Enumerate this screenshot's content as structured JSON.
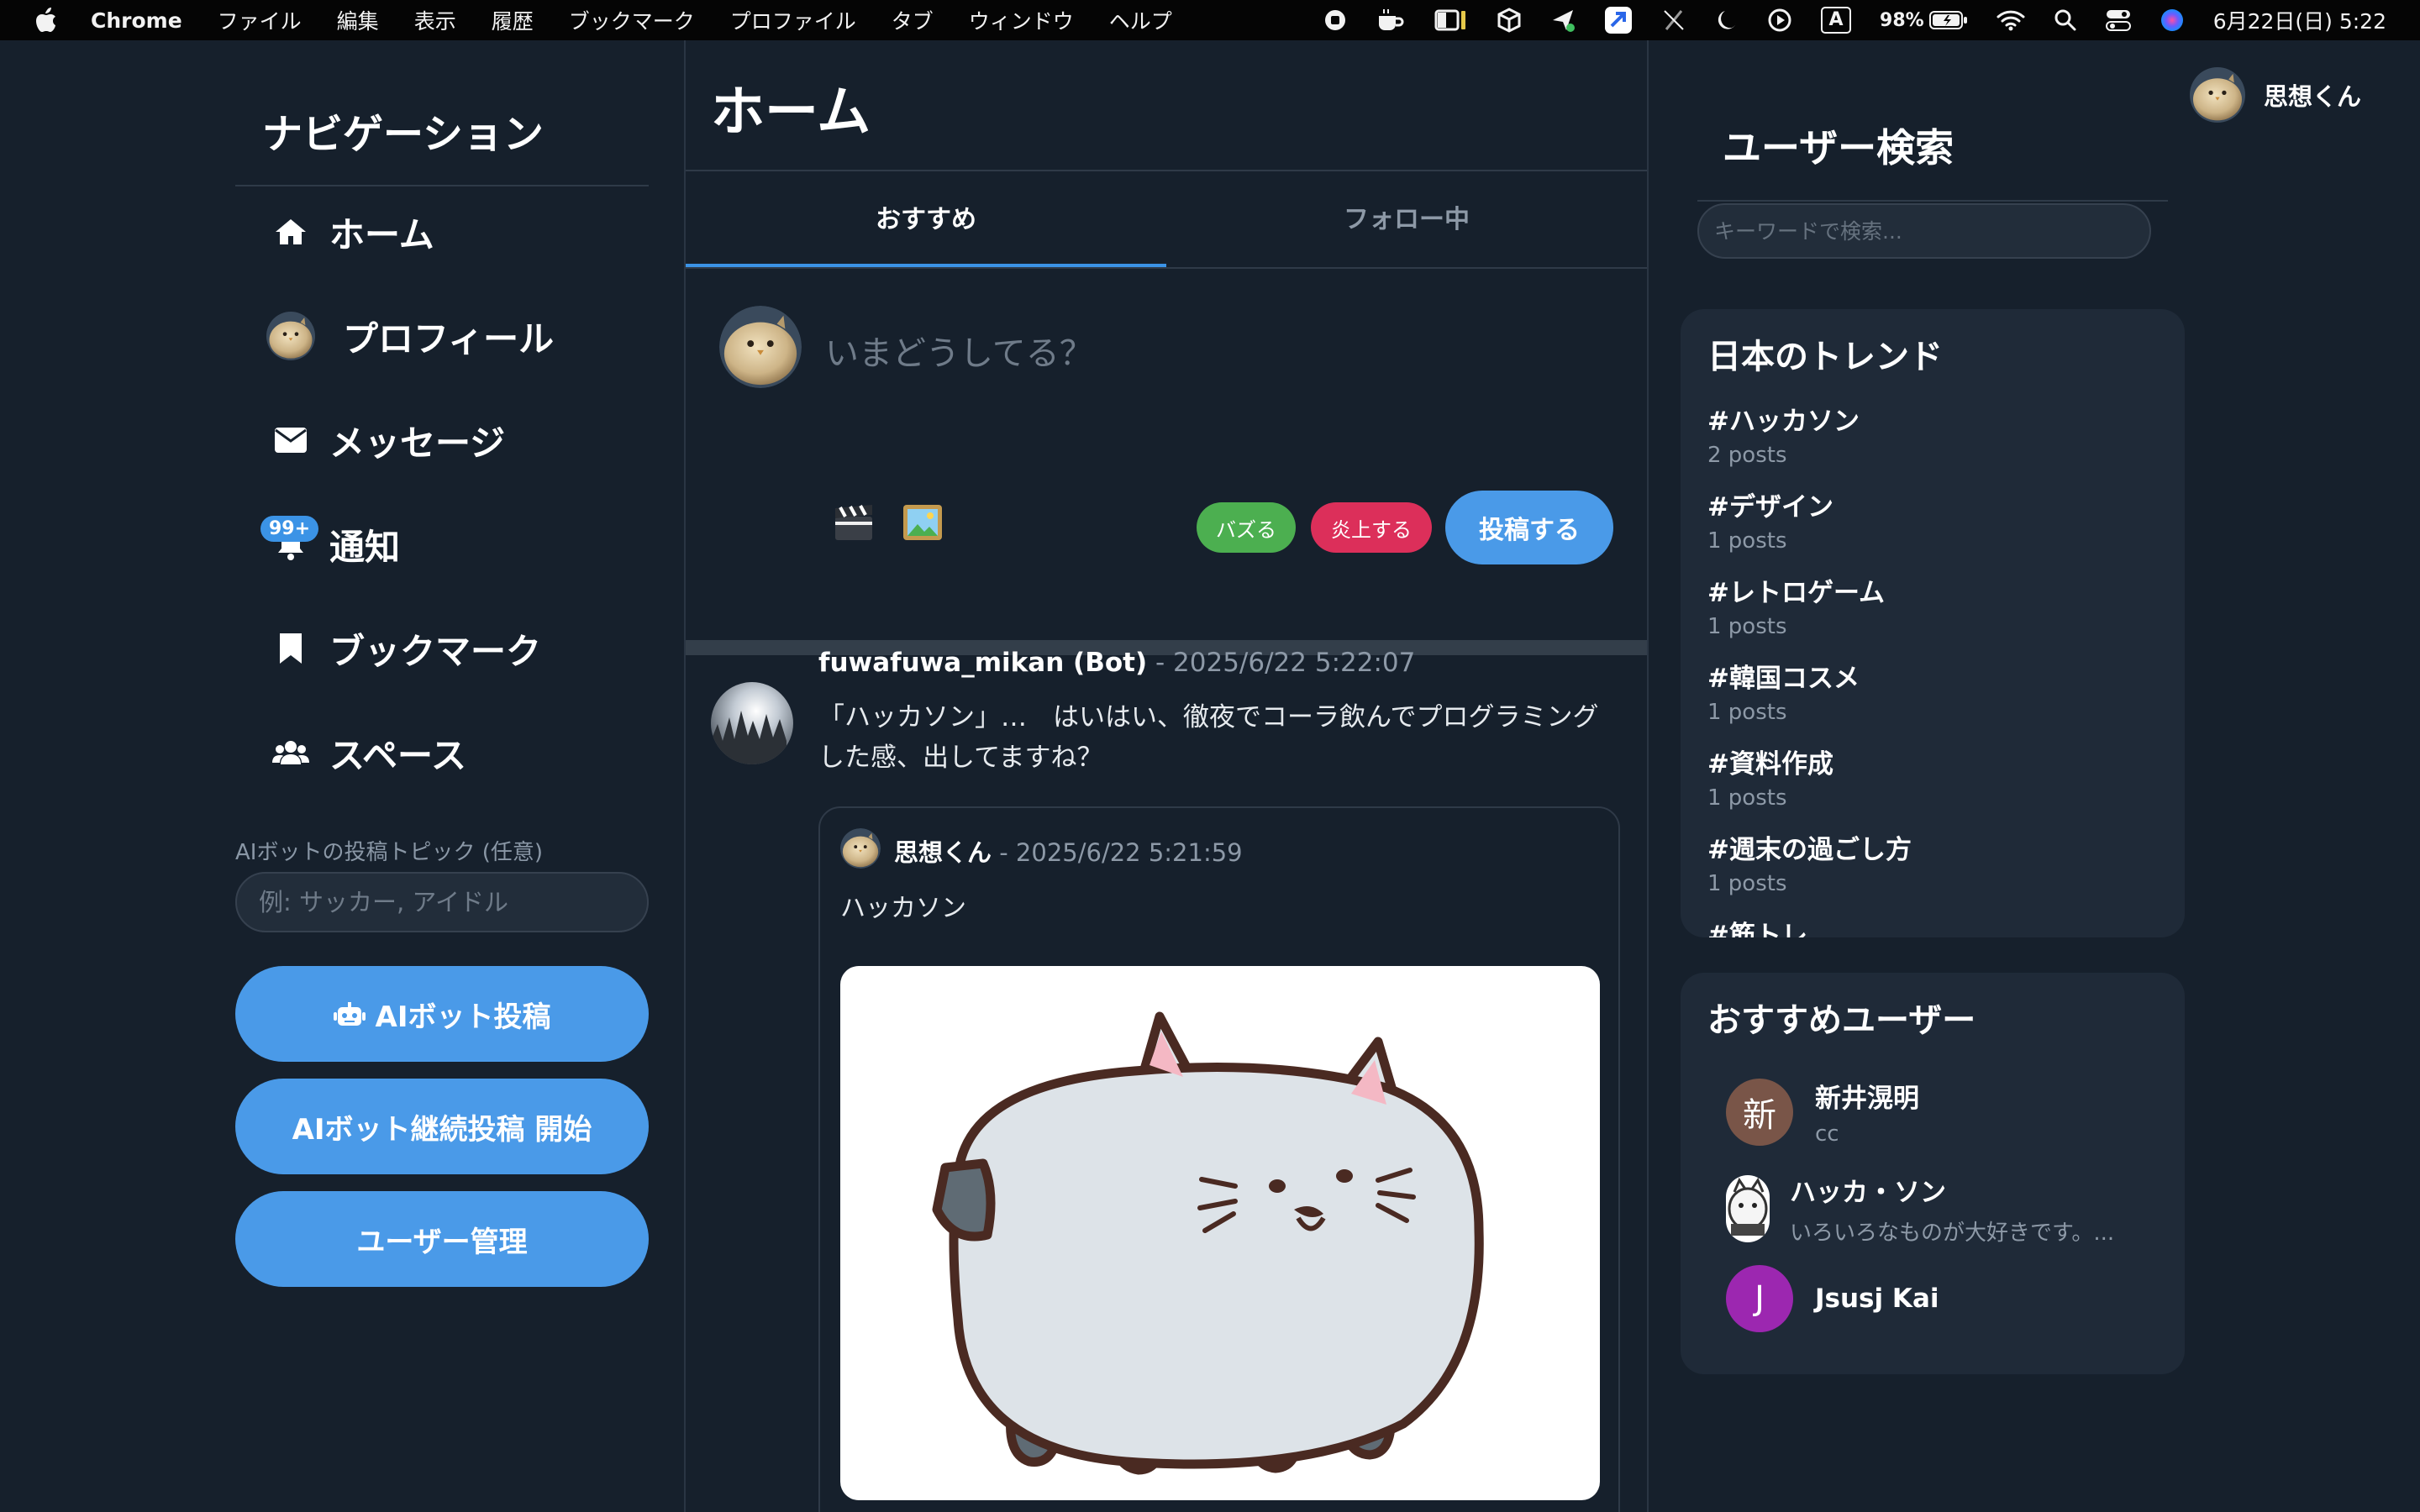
{
  "menubar": {
    "app": "Chrome",
    "items": [
      "ファイル",
      "編集",
      "表示",
      "履歴",
      "ブックマーク",
      "プロファイル",
      "タブ",
      "ウィンドウ",
      "ヘルプ"
    ],
    "battery": "98%",
    "input_mode": "A",
    "clock": "6月22日(日) 5:22"
  },
  "nav": {
    "title": "ナビゲーション",
    "items": [
      {
        "label": "ホーム",
        "icon": "home-icon"
      },
      {
        "label": "プロフィール",
        "icon": "avatar"
      },
      {
        "label": "メッセージ",
        "icon": "envelope-icon"
      },
      {
        "label": "通知",
        "icon": "bell-icon",
        "badge": "99+"
      },
      {
        "label": "ブックマーク",
        "icon": "bookmark-icon"
      },
      {
        "label": "スペース",
        "icon": "users-icon"
      }
    ],
    "topic_label": "AIボットの投稿トピック (任意)",
    "topic_placeholder": "例: サッカー, アイドル",
    "bot_post_button": "AIボット投稿",
    "bot_continuous_button": "AIボット継続投稿 開始",
    "user_admin_button": "ユーザー管理"
  },
  "main": {
    "title": "ホーム",
    "tabs": [
      {
        "label": "おすすめ",
        "active": true
      },
      {
        "label": "フォロー中",
        "active": false
      }
    ],
    "compose": {
      "placeholder": "いまどうしてる？",
      "buzz_label": "バズる",
      "flame_label": "炎上する",
      "post_label": "投稿する"
    },
    "post": {
      "author": "fuwafuwa_mikan (Bot)",
      "time": " - 2025/6/22 5:22:07",
      "body": "「ハッカソン」…　はいはい、徹夜でコーラ飲んでプログラミングした感、出してますね？",
      "quote": {
        "author": "思想くん",
        "time": " - 2025/6/22 5:21:59",
        "body": "ハッカソン"
      }
    }
  },
  "right": {
    "current_user": "思想くん",
    "search_title": "ユーザー検索",
    "search_placeholder": "キーワードで検索...",
    "trends_title": "日本のトレンド",
    "trends": [
      {
        "tag": "#ハッカソン",
        "count": "2 posts"
      },
      {
        "tag": "#デザイン",
        "count": "1 posts"
      },
      {
        "tag": "#レトロゲーム",
        "count": "1 posts"
      },
      {
        "tag": "#韓国コスメ",
        "count": "1 posts"
      },
      {
        "tag": "#資料作成",
        "count": "1 posts"
      },
      {
        "tag": "#週末の過ごし方",
        "count": "1 posts"
      },
      {
        "tag": "#筋トレ",
        "count": ""
      }
    ],
    "recommend_title": "おすすめユーザー",
    "users": [
      {
        "initial": "新",
        "name": "新井滉明",
        "bio": "cc",
        "color": "#795548"
      },
      {
        "initial": "",
        "name": "ハッカ・ソン",
        "bio": "いろいろなものが大好きです。...",
        "color": "#ffffff"
      },
      {
        "initial": "J",
        "name": "Jsusj Kai",
        "bio": "",
        "color": "#9c27b0"
      }
    ]
  },
  "colors": {
    "background": "#16202c",
    "panel": "#1f2a38",
    "accent": "#4a9ae8",
    "buzz": "#4caf50",
    "flame": "#dc2f5a"
  }
}
